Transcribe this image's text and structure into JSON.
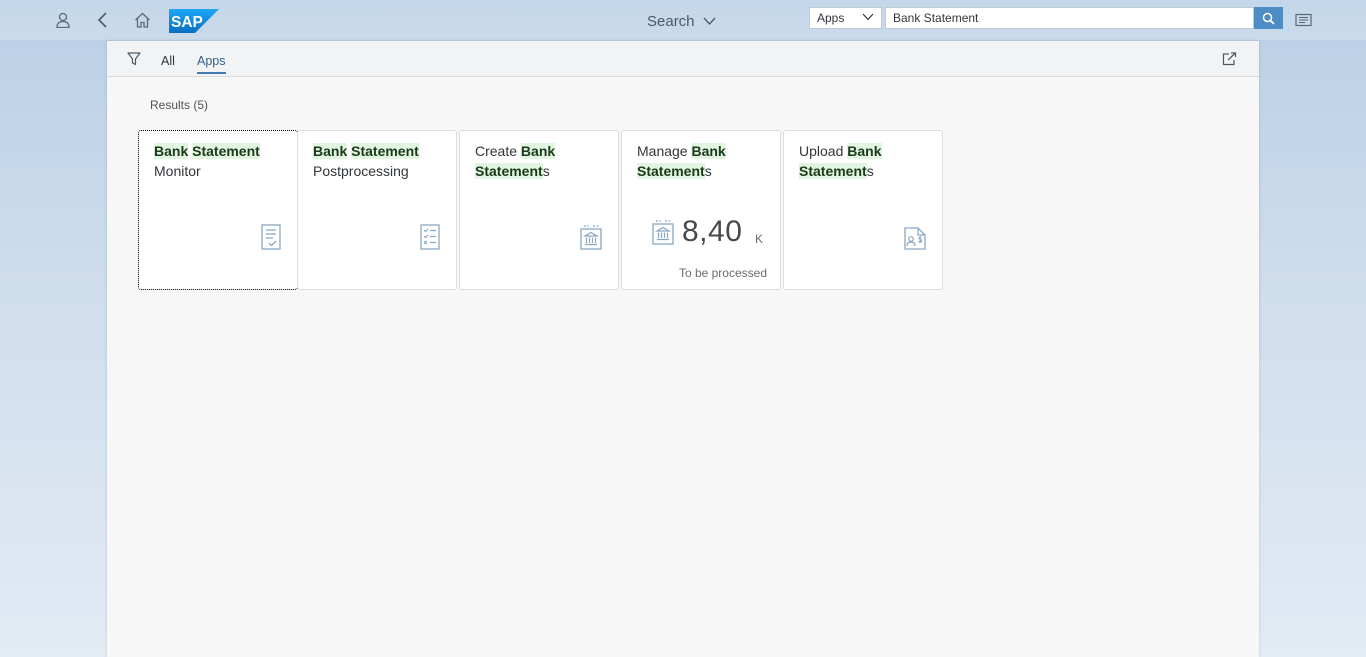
{
  "header": {
    "icons": {
      "user": "user-icon",
      "back": "back-icon",
      "home": "home-icon",
      "search_go": "search-icon",
      "notifications": "notifications-icon"
    },
    "logo_text": "SAP",
    "search_label": "Search",
    "scope": {
      "selected": "Apps"
    },
    "search": {
      "value": "Bank Statement"
    }
  },
  "tabs": [
    {
      "label": "All"
    },
    {
      "label": "Apps"
    }
  ],
  "results_label": "Results (5)",
  "tiles": [
    {
      "title_parts": [
        {
          "text": "Bank",
          "highlight": true
        },
        {
          "text": " ",
          "highlight": false
        },
        {
          "text": "Statement",
          "highlight": true
        },
        {
          "text": " Monitor",
          "highlight": false
        }
      ],
      "icon": "monitor-document-icon"
    },
    {
      "title_parts": [
        {
          "text": "Bank",
          "highlight": true
        },
        {
          "text": " ",
          "highlight": false
        },
        {
          "text": "Statement",
          "highlight": true
        },
        {
          "text": " Postprocessing",
          "highlight": false
        }
      ],
      "icon": "checklist-icon"
    },
    {
      "title_parts": [
        {
          "text": "Create ",
          "highlight": false
        },
        {
          "text": "Bank",
          "highlight": true
        },
        {
          "text": " ",
          "highlight": false
        },
        {
          "text": "Statement",
          "highlight": true
        },
        {
          "text": "s",
          "highlight": false
        }
      ],
      "icon": "bank-statement-icon"
    },
    {
      "title_parts": [
        {
          "text": "Manage ",
          "highlight": false
        },
        {
          "text": "Bank",
          "highlight": true
        },
        {
          "text": " ",
          "highlight": false
        },
        {
          "text": "Statement",
          "highlight": true
        },
        {
          "text": "s",
          "highlight": false
        }
      ],
      "icon": "bank-statement-icon",
      "kpi": {
        "value": "8,40",
        "scale": "K",
        "footer": "To be processed"
      }
    },
    {
      "title_parts": [
        {
          "text": "Upload ",
          "highlight": false
        },
        {
          "text": "Bank",
          "highlight": true
        },
        {
          "text": " ",
          "highlight": false
        },
        {
          "text": "Statement",
          "highlight": true
        },
        {
          "text": "s",
          "highlight": false
        }
      ],
      "icon": "customer-invoice-icon"
    }
  ],
  "colors": {
    "accent": "#427cac",
    "highlight": "#e1f5e1",
    "brand": "#1a8fd8"
  }
}
